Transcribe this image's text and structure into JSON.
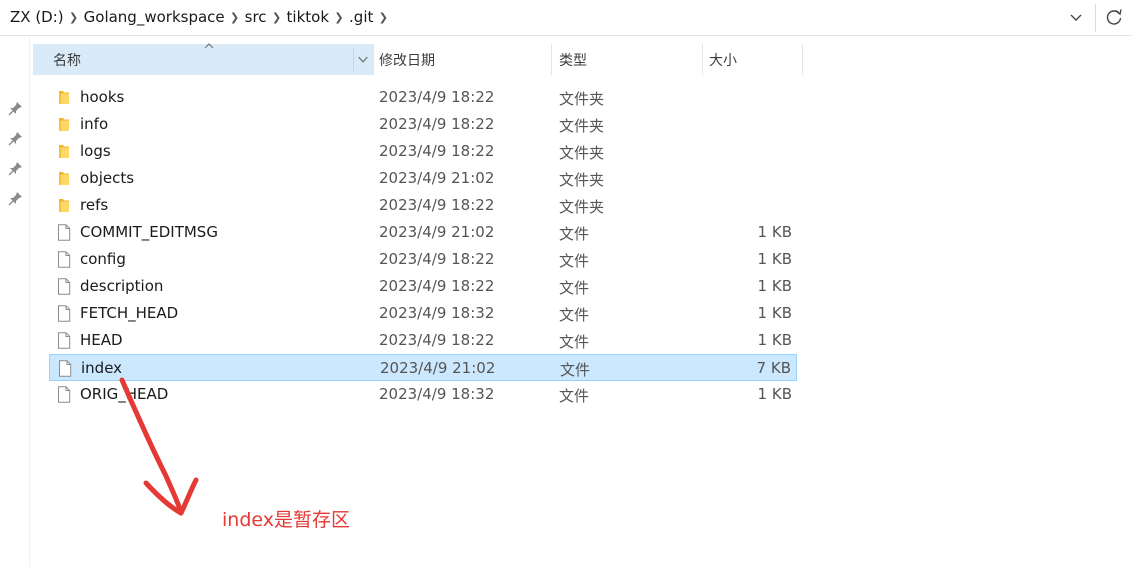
{
  "breadcrumb": [
    "ZX (D:)",
    "Golang_workspace",
    "src",
    "tiktok",
    ".git"
  ],
  "columns": {
    "name": "名称",
    "date": "修改日期",
    "type": "类型",
    "size": "大小"
  },
  "rows": [
    {
      "name": "hooks",
      "date": "2023/4/9 18:22",
      "type": "文件夹",
      "size": "",
      "icon": "folder-icon"
    },
    {
      "name": "info",
      "date": "2023/4/9 18:22",
      "type": "文件夹",
      "size": "",
      "icon": "folder-icon"
    },
    {
      "name": "logs",
      "date": "2023/4/9 18:22",
      "type": "文件夹",
      "size": "",
      "icon": "folder-icon"
    },
    {
      "name": "objects",
      "date": "2023/4/9 21:02",
      "type": "文件夹",
      "size": "",
      "icon": "folder-icon"
    },
    {
      "name": "refs",
      "date": "2023/4/9 18:22",
      "type": "文件夹",
      "size": "",
      "icon": "folder-icon"
    },
    {
      "name": "COMMIT_EDITMSG",
      "date": "2023/4/9 21:02",
      "type": "文件",
      "size": "1 KB",
      "icon": "file-icon"
    },
    {
      "name": "config",
      "date": "2023/4/9 18:22",
      "type": "文件",
      "size": "1 KB",
      "icon": "file-icon"
    },
    {
      "name": "description",
      "date": "2023/4/9 18:22",
      "type": "文件",
      "size": "1 KB",
      "icon": "file-icon"
    },
    {
      "name": "FETCH_HEAD",
      "date": "2023/4/9 18:32",
      "type": "文件",
      "size": "1 KB",
      "icon": "file-icon"
    },
    {
      "name": "HEAD",
      "date": "2023/4/9 18:22",
      "type": "文件",
      "size": "1 KB",
      "icon": "file-icon"
    },
    {
      "name": "index",
      "date": "2023/4/9 21:02",
      "type": "文件",
      "size": "7 KB",
      "icon": "file-icon",
      "selected": true
    },
    {
      "name": "ORIG_HEAD",
      "date": "2023/4/9 18:32",
      "type": "文件",
      "size": "1 KB",
      "icon": "file-icon"
    }
  ],
  "annotation": {
    "text": "index是暂存区",
    "color": "#e53935"
  },
  "colors": {
    "selection_bg": "#cce8ff",
    "selection_border": "#99d1ff",
    "header_active_bg": "#d9ebf9",
    "folder": "#f5c242"
  }
}
